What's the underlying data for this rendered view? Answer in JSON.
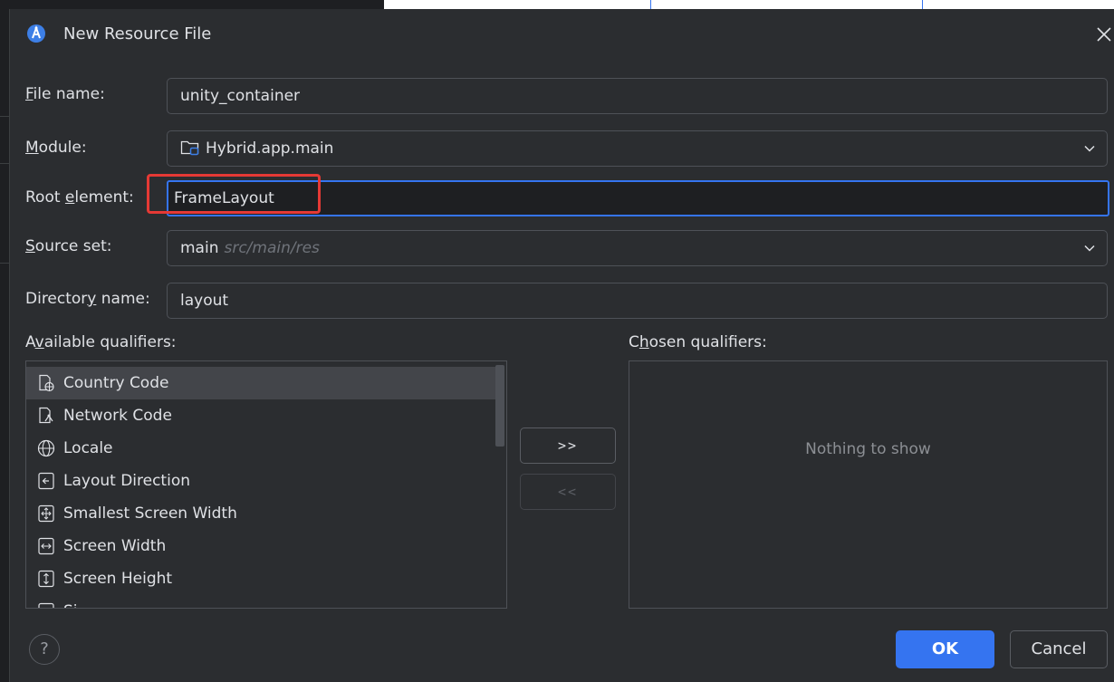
{
  "dialog": {
    "title": "New Resource File",
    "app_icon": "android-studio-icon",
    "close_icon": "close-icon"
  },
  "form": {
    "file_name": {
      "label_u": "F",
      "label_rest": "ile name:",
      "value": "unity_container"
    },
    "module": {
      "label_u": "M",
      "label_rest": "odule:",
      "value": "Hybrid.app.main",
      "icon": "module-folder-icon"
    },
    "root_element": {
      "label_pre": "Root ",
      "label_u": "e",
      "label_rest": "lement:",
      "value": "FrameLayout"
    },
    "source_set": {
      "label_u": "S",
      "label_rest": "ource set:",
      "value": "main",
      "hint": "src/main/res"
    },
    "directory_name": {
      "label_pre": "Director",
      "label_u": "y",
      "label_rest": " name:",
      "value": "layout"
    }
  },
  "qualifiers": {
    "available_label_pre": "A",
    "available_label_u": "v",
    "available_label_rest": "ailable qualifiers:",
    "chosen_label_pre": "C",
    "chosen_label_u": "h",
    "chosen_label_rest": "osen qualifiers:",
    "items": [
      {
        "label": "Country Code",
        "icon": "country-code-icon"
      },
      {
        "label": "Network Code",
        "icon": "network-code-icon"
      },
      {
        "label": "Locale",
        "icon": "globe-icon"
      },
      {
        "label": "Layout Direction",
        "icon": "layout-direction-icon"
      },
      {
        "label": "Smallest Screen Width",
        "icon": "smallest-width-icon"
      },
      {
        "label": "Screen Width",
        "icon": "screen-width-icon"
      },
      {
        "label": "Screen Height",
        "icon": "screen-height-icon"
      },
      {
        "label": "Si",
        "icon": "size-icon"
      }
    ],
    "add_button": ">>",
    "remove_button": "<<",
    "empty_text": "Nothing to show"
  },
  "footer": {
    "help": "?",
    "ok": "OK",
    "cancel": "Cancel"
  },
  "colors": {
    "background": "#2b2d30",
    "accent": "#3574f0",
    "highlight": "#e53935"
  }
}
